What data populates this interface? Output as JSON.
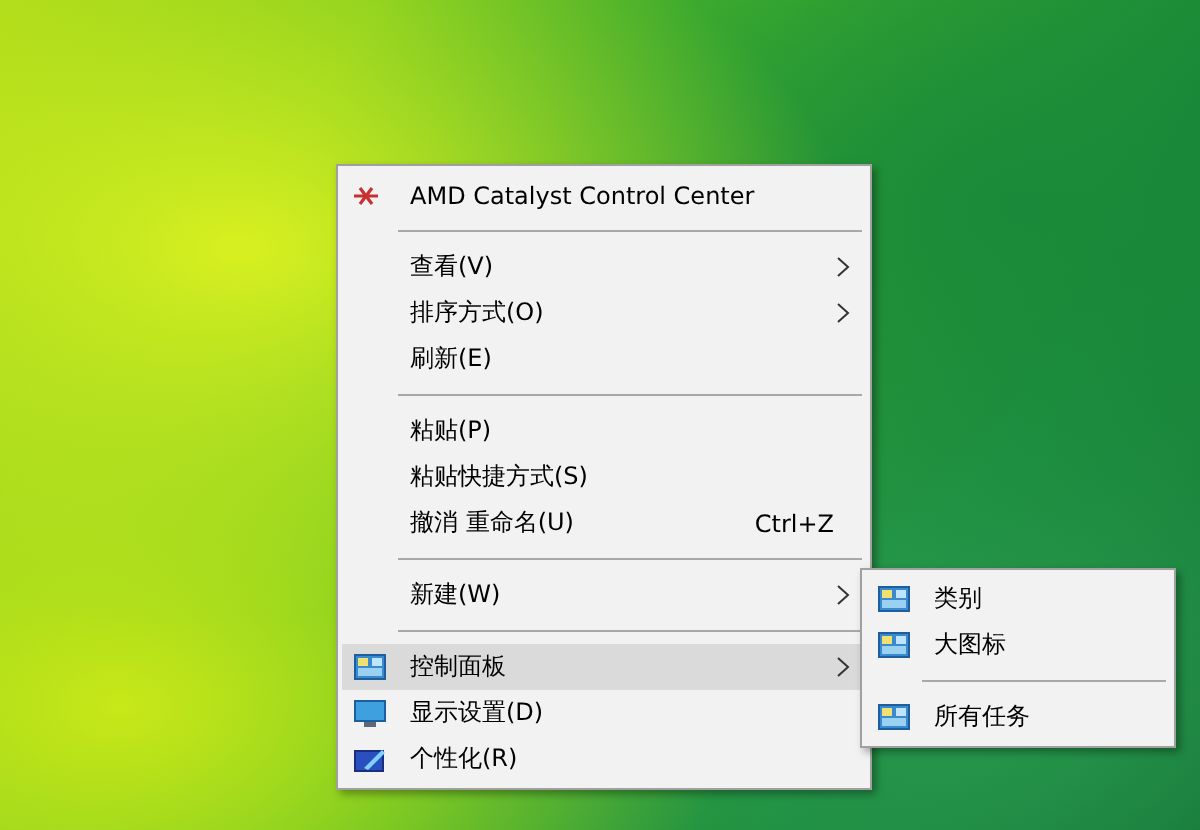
{
  "context_menu": {
    "items": [
      {
        "kind": "app",
        "label": "AMD Catalyst Control Center",
        "selected": false
      },
      {
        "kind": "separator"
      },
      {
        "kind": "plain",
        "label": "查看(V)",
        "has_submenu": true,
        "selected": false
      },
      {
        "kind": "plain",
        "label": "排序方式(O)",
        "has_submenu": true,
        "selected": false
      },
      {
        "kind": "plain",
        "label": "刷新(E)",
        "selected": false
      },
      {
        "kind": "separator"
      },
      {
        "kind": "plain",
        "label": "粘贴(P)",
        "selected": false
      },
      {
        "kind": "plain",
        "label": "粘贴快捷方式(S)",
        "selected": false
      },
      {
        "kind": "plain",
        "label": "撤消 重命名(U)",
        "shortcut": "Ctrl+Z",
        "selected": false
      },
      {
        "kind": "separator"
      },
      {
        "kind": "plain",
        "label": "新建(W)",
        "has_submenu": true,
        "selected": false
      },
      {
        "kind": "separator"
      },
      {
        "kind": "panel",
        "label": "控制面板",
        "has_submenu": true,
        "selected": true
      },
      {
        "kind": "display",
        "label": "显示设置(D)",
        "selected": false
      },
      {
        "kind": "personalize",
        "label": "个性化(R)",
        "selected": false
      }
    ]
  },
  "submenu": {
    "items": [
      {
        "kind": "panel",
        "label": "类别"
      },
      {
        "kind": "panel",
        "label": "大图标"
      },
      {
        "kind": "separator"
      },
      {
        "kind": "panel",
        "label": "所有任务"
      }
    ]
  }
}
